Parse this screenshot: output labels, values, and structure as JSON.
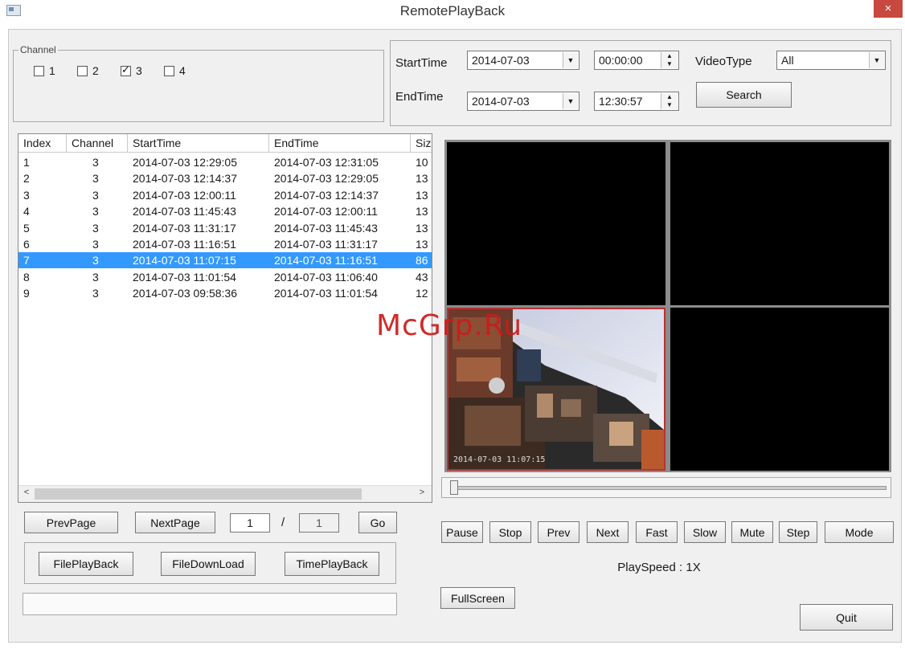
{
  "window": {
    "title": "RemotePlayBack",
    "close_label": "×"
  },
  "channel": {
    "legend": "Channel",
    "items": [
      {
        "label": "1",
        "checked": false
      },
      {
        "label": "2",
        "checked": false
      },
      {
        "label": "3",
        "checked": true
      },
      {
        "label": "4",
        "checked": false
      }
    ]
  },
  "search": {
    "start_label": "StartTime",
    "start_date": "2014-07-03",
    "start_time": "00:00:00",
    "end_label": "EndTime",
    "end_date": "2014-07-03",
    "end_time": "12:30:57",
    "video_type_label": "VideoType",
    "video_type": "All",
    "search_button": "Search"
  },
  "files": {
    "columns": [
      "Index",
      "Channel",
      "StartTime",
      "EndTime",
      "Siz"
    ],
    "rows": [
      [
        "1",
        "3",
        "2014-07-03 12:29:05",
        "2014-07-03 12:31:05",
        "10"
      ],
      [
        "2",
        "3",
        "2014-07-03 12:14:37",
        "2014-07-03 12:29:05",
        "13"
      ],
      [
        "3",
        "3",
        "2014-07-03 12:00:11",
        "2014-07-03 12:14:37",
        "13"
      ],
      [
        "4",
        "3",
        "2014-07-03 11:45:43",
        "2014-07-03 12:00:11",
        "13"
      ],
      [
        "5",
        "3",
        "2014-07-03 11:31:17",
        "2014-07-03 11:45:43",
        "13"
      ],
      [
        "6",
        "3",
        "2014-07-03 11:16:51",
        "2014-07-03 11:31:17",
        "13"
      ],
      [
        "7",
        "3",
        "2014-07-03 11:07:15",
        "2014-07-03 11:16:51",
        "86"
      ],
      [
        "8",
        "3",
        "2014-07-03 11:01:54",
        "2014-07-03 11:06:40",
        "43"
      ],
      [
        "9",
        "3",
        "2014-07-03 09:58:36",
        "2014-07-03 11:01:54",
        "12"
      ]
    ],
    "selected_index": 6
  },
  "paging": {
    "prev": "PrevPage",
    "next": "NextPage",
    "current": "1",
    "sep": "/",
    "total": "1",
    "go": "Go"
  },
  "actions": {
    "file_playback": "FilePlayBack",
    "file_download": "FileDownLoad",
    "time_playback": "TimePlayBack"
  },
  "controls": [
    "Pause",
    "Stop",
    "Prev",
    "Next",
    "Fast",
    "Slow",
    "Mute",
    "Step",
    "Mode"
  ],
  "play_speed": "PlaySpeed : 1X",
  "fullscreen": "FullScreen",
  "quit": "Quit",
  "video": {
    "timestamp": "2014-07-03 11:07:15"
  },
  "watermark": "McGrp.Ru",
  "colors": {
    "selection": "#3399ff",
    "active_window": "#b83232",
    "close": "#c7483f"
  }
}
